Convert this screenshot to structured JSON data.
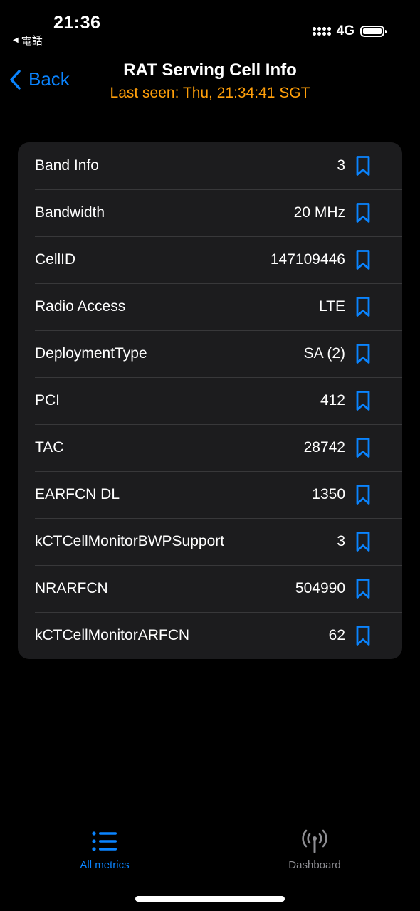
{
  "colors": {
    "accent": "#0a84ff",
    "subtitle": "#ff9f0a",
    "inactive_tab": "#8e8e93",
    "card_bg": "#1c1c1e"
  },
  "status_bar": {
    "time": "21:36",
    "back_app": "電話",
    "network": "4G"
  },
  "nav": {
    "back_label": "Back",
    "title": "RAT Serving Cell Info",
    "subtitle": "Last seen: Thu, 21:34:41 SGT"
  },
  "rows": [
    {
      "label": "Band Info",
      "value": "3",
      "icon": "bookmark-icon"
    },
    {
      "label": "Bandwidth",
      "value": "20 MHz",
      "icon": "bookmark-icon"
    },
    {
      "label": "CellID",
      "value": "147109446",
      "icon": "bookmark-icon"
    },
    {
      "label": "Radio Access",
      "value": "LTE",
      "icon": "bookmark-icon"
    },
    {
      "label": "DeploymentType",
      "value": "SA (2)",
      "icon": "bookmark-icon"
    },
    {
      "label": "PCI",
      "value": "412",
      "icon": "bookmark-icon"
    },
    {
      "label": "TAC",
      "value": "28742",
      "icon": "bookmark-icon"
    },
    {
      "label": "EARFCN DL",
      "value": "1350",
      "icon": "bookmark-icon"
    },
    {
      "label": "kCTCellMonitorBWPSupport",
      "value": "3",
      "icon": "bookmark-icon"
    },
    {
      "label": "NRARFCN",
      "value": "504990",
      "icon": "bookmark-icon"
    },
    {
      "label": "kCTCellMonitorARFCN",
      "value": "62",
      "icon": "bookmark-icon"
    }
  ],
  "tabbar": {
    "tabs": [
      {
        "label": "All metrics",
        "icon": "list-icon",
        "active": true
      },
      {
        "label": "Dashboard",
        "icon": "antenna-icon",
        "active": false
      }
    ]
  }
}
